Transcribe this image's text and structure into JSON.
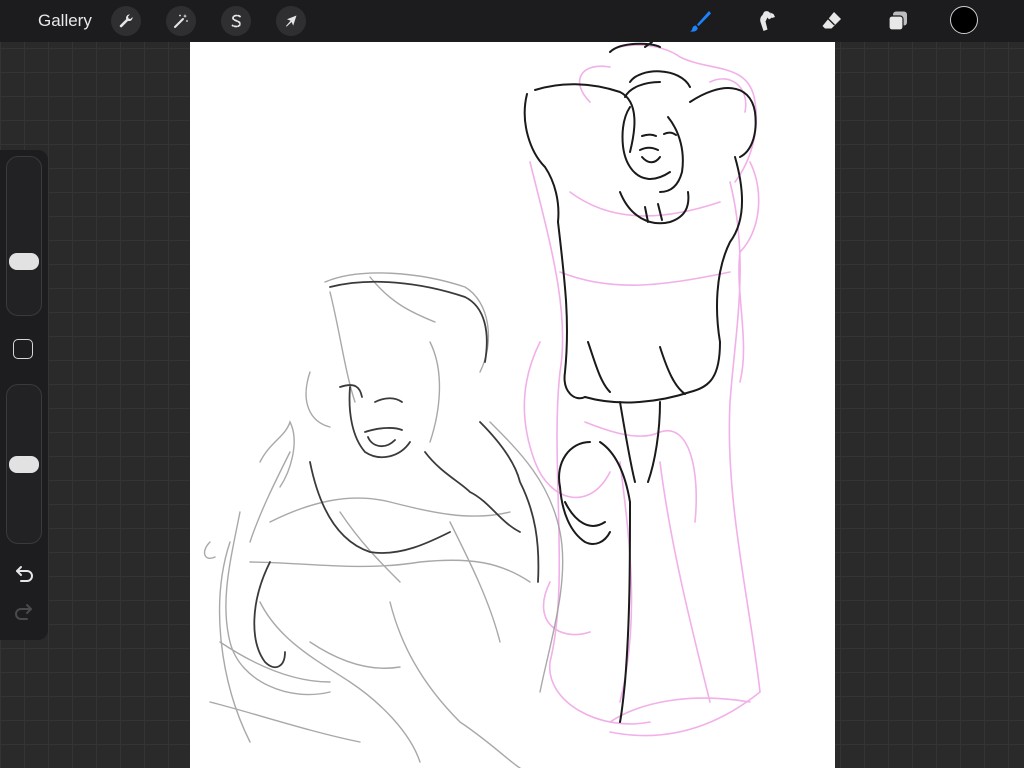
{
  "toolbar": {
    "gallery_label": "Gallery",
    "left_tools": [
      {
        "name": "actions",
        "icon": "wrench-icon"
      },
      {
        "name": "adjustments",
        "icon": "magic-wand-icon"
      },
      {
        "name": "selection",
        "icon": "selection-s-icon"
      },
      {
        "name": "transform",
        "icon": "arrow-cursor-icon"
      }
    ],
    "right_tools": [
      {
        "name": "brush",
        "icon": "brush-icon",
        "active": true
      },
      {
        "name": "smudge",
        "icon": "smudge-icon"
      },
      {
        "name": "eraser",
        "icon": "eraser-icon"
      },
      {
        "name": "layers",
        "icon": "layers-icon"
      }
    ],
    "current_color": "#000000",
    "active_color": "#1a84ff"
  },
  "sidebar": {
    "brush_size_level": 0.32,
    "opacity_level": 0.5,
    "modify_button": "square-icon",
    "undo": "undo-icon",
    "redo": "redo-icon"
  },
  "colors": {
    "pencil": "#2a2a2a",
    "sketch_gray": "#9a9a9a",
    "guide_pink": "#f0a8e6"
  }
}
